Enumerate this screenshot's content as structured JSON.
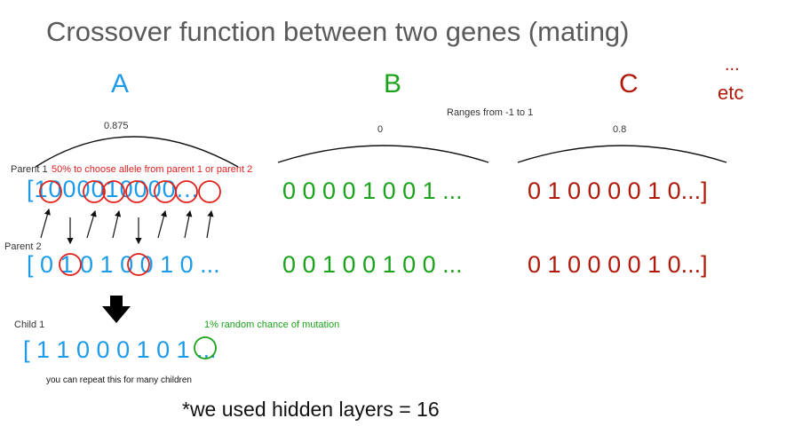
{
  "title": "Crossover function between two genes (mating)",
  "genes": {
    "a": {
      "label": "A",
      "value": "0.875"
    },
    "b": {
      "label": "B",
      "value": "0"
    },
    "c": {
      "label": "C",
      "value": "0.8"
    },
    "etc_dots": "...",
    "etc": "etc"
  },
  "range_note": "Ranges from -1 to 1",
  "parent1": {
    "label": "Parent 1",
    "note": "50% to choose allele from parent 1 or parent 2",
    "a_bits": "[1000010000...",
    "b_bits": "0 0 0 0 1 0 0 1 ...",
    "c_bits": "0 1 0 0 0 0 1 0...]"
  },
  "parent2": {
    "label": "Parent 2",
    "a_bits": "[ 0 1 0 1 0 0 1 0 ...",
    "b_bits": "0 0 1 0 0 1 0 0 ...",
    "c_bits": "0 1 0 0 0 0 1 0...]"
  },
  "child": {
    "label": "Child 1",
    "bits": "[ 1 1 0 0 0 1 0 1 ...",
    "mutation_note": "1% random chance of mutation",
    "repeat_note": "you can repeat this for many children"
  },
  "footnote": "*we used hidden layers = 16"
}
